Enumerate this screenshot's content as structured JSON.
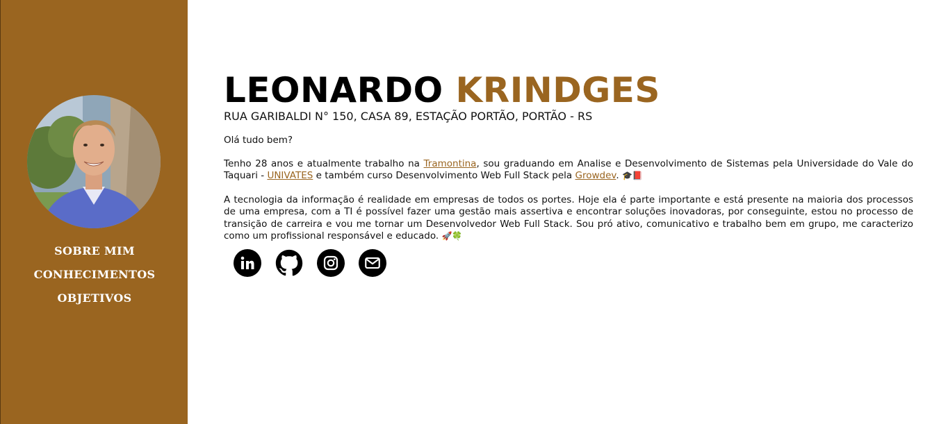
{
  "sidebar": {
    "nav": [
      {
        "label": "SOBRE MIM"
      },
      {
        "label": "CONHECIMENTOS"
      },
      {
        "label": "OBJETIVOS"
      }
    ],
    "avatar_icon": "profile-photo"
  },
  "header": {
    "first_name": "LEONARDO",
    "last_name": "KRINDGES",
    "address": "RUA GARIBALDI N° 150, CASA 89, ESTAÇÃO PORTÃO, PORTÃO - RS"
  },
  "about": {
    "greeting": "Olá tudo bem?",
    "p2_a": "Tenho 28 anos e atualmente trabalho na ",
    "link_company": "Tramontina",
    "p2_b": ", sou graduando em Analise e Desenvolvimento de Sistemas pela Universidade do Vale do Taquari - ",
    "link_university": "UNIVATES",
    "p2_c": " e também curso Desenvolvimento Web Full Stack pela ",
    "link_course": "Growdev",
    "p2_d": ". ",
    "p2_emoji": "🎓📕",
    "p3": "A tecnologia da informação é realidade em empresas de todos os portes. Hoje ela é parte importante e está presente na maioria dos processos de uma empresa, com a TI é possível fazer uma gestão mais assertiva e encontrar soluções inovadoras, por conseguinte, estou no processo de transição de carreira e vou me tornar um Desenvolvedor Web Full Stack. Sou pró ativo, comunicativo e trabalho bem em grupo, me caracterizo como um profissional responsável e educado.",
    "p3_emoji": "🚀🍀"
  },
  "socials": [
    "linkedin-icon",
    "github-icon",
    "instagram-icon",
    "mail-icon"
  ],
  "colors": {
    "accent": "#9a6520",
    "text": "#000000",
    "background": "#ffffff"
  }
}
